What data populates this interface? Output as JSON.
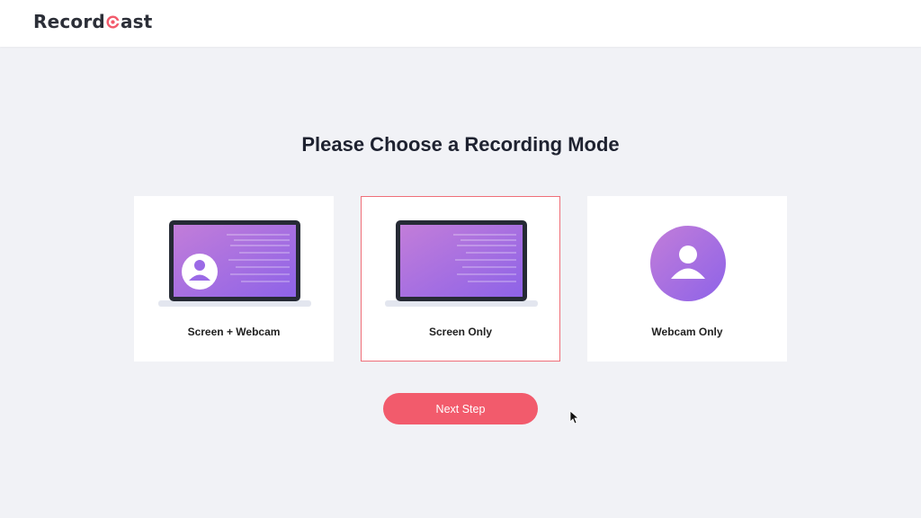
{
  "app": {
    "logo_text_before": "Record",
    "logo_text_after": "ast",
    "brand_color": "#f25b6c"
  },
  "main": {
    "title": "Please Choose a Recording Mode",
    "modes": [
      {
        "label": "Screen + Webcam",
        "icon": "laptop-with-avatar-icon",
        "selected": false
      },
      {
        "label": "Screen Only",
        "icon": "laptop-icon",
        "selected": true
      },
      {
        "label": "Webcam Only",
        "icon": "user-avatar-icon",
        "selected": false
      }
    ],
    "next_button_label": "Next Step"
  },
  "colors": {
    "accent": "#f25b6c",
    "selected_border": "#ef6f79",
    "illustration_gradient_start": "#c27dd9",
    "illustration_gradient_end": "#8e63e8"
  }
}
